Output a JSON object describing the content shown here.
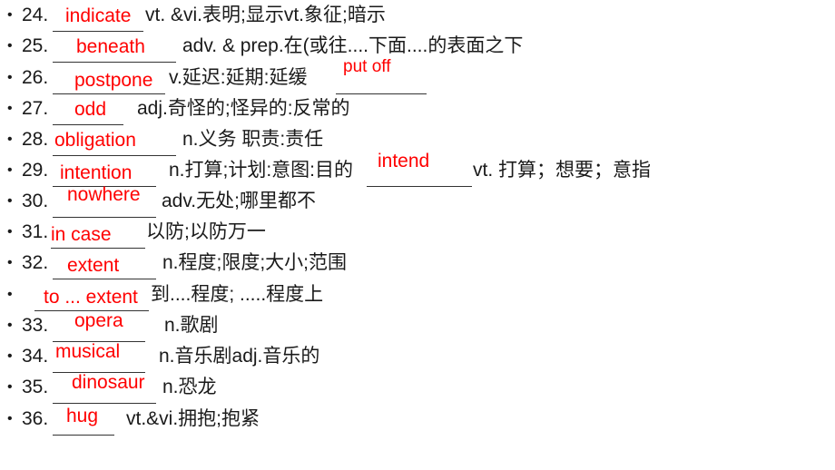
{
  "items": [
    {
      "number": "24.",
      "answer": "indicate",
      "definition": "vt. &vi.表明;显示vt.象征;暗示"
    },
    {
      "number": "25.",
      "answer": "beneath",
      "definition": "adv. & prep.在(或往....下面....的表面之下"
    },
    {
      "number": "26.",
      "answer": "postpone",
      "definition": "v.延迟:延期:延缓",
      "extra_answer": "put off"
    },
    {
      "number": "27.",
      "answer": "odd",
      "definition": "adj.奇怪的;怪异的:反常的"
    },
    {
      "number": "28.",
      "answer": "obligation",
      "definition": "n.义务 职责:责任"
    },
    {
      "number": "29.",
      "answer": "intention",
      "definition": "n.打算;计划:意图:目的",
      "extra_answer": "intend",
      "extra_definition": "vt. 打算；想要；意指"
    },
    {
      "number": "30.",
      "answer": "nowhere",
      "definition": "adv.无处;哪里都不"
    },
    {
      "number": "31.",
      "answer": "in case",
      "definition": "以防;以防万一"
    },
    {
      "number": "32.",
      "answer": "extent",
      "definition": "n.程度;限度;大小;范围"
    },
    {
      "number": "",
      "answer": "to ... extent",
      "definition": "到....程度; .....程度上"
    },
    {
      "number": "33.",
      "answer": "opera",
      "definition": "n.歌剧"
    },
    {
      "number": "34.",
      "answer": "musical",
      "definition": "n.音乐剧adj.音乐的"
    },
    {
      "number": "35.",
      "answer": "dinosaur",
      "definition": "n.恐龙"
    },
    {
      "number": "36.",
      "answer": "hug",
      "definition": "vt.&vi.拥抱;抱紧"
    }
  ],
  "bullet_glyph": "•"
}
